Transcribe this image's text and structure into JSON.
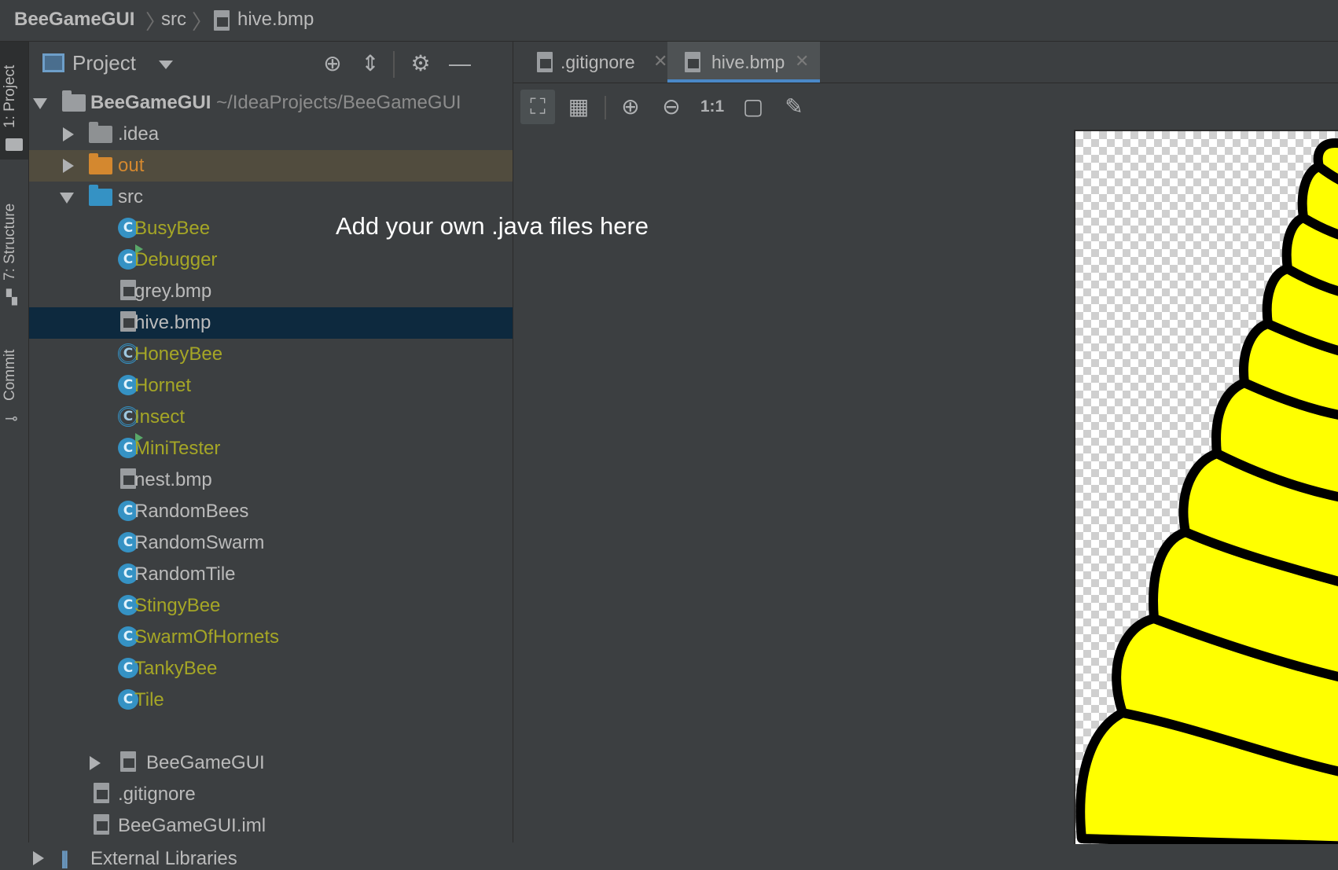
{
  "breadcrumb": {
    "project": "BeeGameGUI",
    "folder": "src",
    "file": "hive.bmp"
  },
  "sidebar_tabs": {
    "project": "1: Project",
    "structure": "7: Structure",
    "commit": "Commit"
  },
  "panel": {
    "title": "Project",
    "icons": [
      "locate-icon",
      "collapse-all-icon",
      "gear-icon",
      "minimize-icon"
    ]
  },
  "tree": {
    "root_label": "BeeGameGUI",
    "root_path": "~/IdeaProjects/BeeGameGUI",
    "idea": ".idea",
    "out": "out",
    "src": "src",
    "src_items": [
      {
        "label": "BusyBee",
        "kind": "class",
        "color": "olive"
      },
      {
        "label": "Debugger",
        "kind": "runnable",
        "color": "olive"
      },
      {
        "label": "grey.bmp",
        "kind": "image",
        "color": "plain"
      },
      {
        "label": "hive.bmp",
        "kind": "image",
        "color": "plain",
        "selected": true
      },
      {
        "label": "HoneyBee",
        "kind": "abstract",
        "color": "olive"
      },
      {
        "label": "Hornet",
        "kind": "class",
        "color": "olive"
      },
      {
        "label": "Insect",
        "kind": "abstract",
        "color": "olive"
      },
      {
        "label": "MiniTester",
        "kind": "runnable",
        "color": "olive"
      },
      {
        "label": "nest.bmp",
        "kind": "image",
        "color": "plain"
      },
      {
        "label": "RandomBees",
        "kind": "class",
        "color": "plain"
      },
      {
        "label": "RandomSwarm",
        "kind": "class",
        "color": "plain"
      },
      {
        "label": "RandomTile",
        "kind": "class",
        "color": "plain"
      },
      {
        "label": "StingyBee",
        "kind": "class",
        "color": "olive"
      },
      {
        "label": "SwarmOfHornets",
        "kind": "class",
        "color": "olive"
      },
      {
        "label": "TankyBee",
        "kind": "class",
        "color": "olive"
      },
      {
        "label": "Tile",
        "kind": "class",
        "color": "olive"
      }
    ],
    "src_sub": "BeeGameGUI",
    "gitignore": ".gitignore",
    "iml": "BeeGameGUI.iml",
    "external": "External Libraries"
  },
  "tabs": [
    {
      "label": ".gitignore",
      "active": false
    },
    {
      "label": "hive.bmp",
      "active": true
    }
  ],
  "image_toolbar": {
    "actual_size_label": "1:1",
    "icons": [
      "fit-zoom-icon",
      "grid-icon",
      "zoom-in-icon",
      "zoom-out-icon",
      "actual-size-icon",
      "background-icon",
      "color-picker-icon"
    ]
  },
  "annotation": "Add your own .java files here",
  "colors": {
    "accent": "#4a88c7",
    "olive_text": "#a5a626",
    "selection": "#0d293e",
    "hive_yellow": "#ffff00"
  }
}
